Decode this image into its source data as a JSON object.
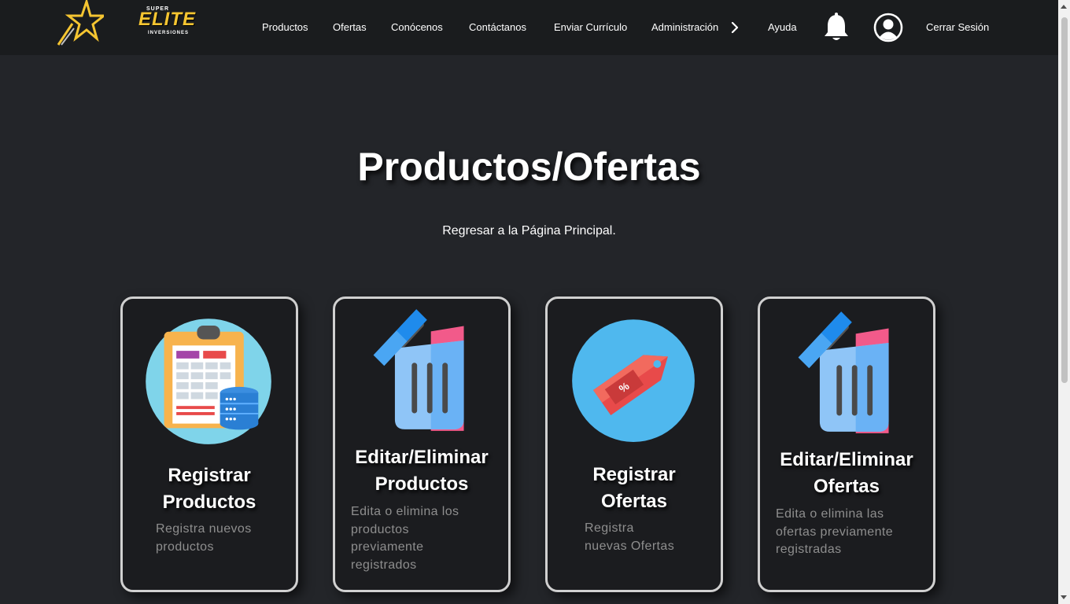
{
  "brand": {
    "super": "SUPER",
    "elite": "ELITE",
    "inversiones": "INVERSIONES"
  },
  "nav": {
    "productos": "Productos",
    "ofertas": "Ofertas",
    "conocenos": "Conócenos",
    "contactanos": "Contáctanos",
    "enviar_curriculo": "Enviar Currículo",
    "administracion": "Administración",
    "ayuda": "Ayuda",
    "cerrar_sesion": "Cerrar Sesión",
    "icons": [
      "notification-bell-icon",
      "user-account-icon",
      "chevron-right-icon"
    ]
  },
  "main": {
    "title": "Productos/Ofertas",
    "back_link": "Regresar a la Página Principal."
  },
  "cards": [
    {
      "title_line1": "Registrar",
      "title_line2": "Productos",
      "desc": [
        "Registra nuevos",
        "productos"
      ],
      "icon": "clipboard-database-icon"
    },
    {
      "title_line1": "Editar/Eliminar",
      "title_line2": "Productos",
      "desc": [
        "Edita o elimina los",
        "productos",
        "previamente",
        "registrados"
      ],
      "icon": "trash-can-icon"
    },
    {
      "title_line1": "Registrar",
      "title_line2": "Ofertas",
      "desc": [
        "Registra",
        "nuevas Ofertas"
      ],
      "icon": "price-tag-icon"
    },
    {
      "title_line1": "Editar/Eliminar",
      "title_line2": "Ofertas",
      "desc": [
        "Edita o elimina las",
        "ofertas previamente",
        "registradas"
      ],
      "icon": "trash-can-icon"
    }
  ],
  "colors": {
    "background": "#232529",
    "navbar": "#1a1c1e",
    "card": "#1b1c1f",
    "card_border": "#d0d0d0",
    "logo_gold": "#f5c531",
    "muted_text": "#8e8e8e"
  }
}
